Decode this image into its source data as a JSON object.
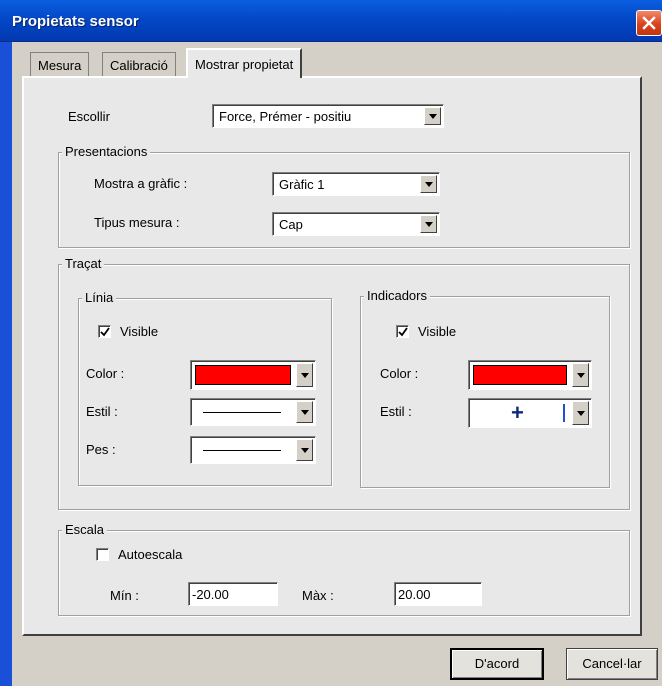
{
  "window": {
    "title": "Propietats sensor"
  },
  "tabs": [
    {
      "label": "Mesura",
      "active": false
    },
    {
      "label": "Calibració",
      "active": false
    },
    {
      "label": "Mostrar propietat",
      "active": true
    }
  ],
  "choose": {
    "label": "Escollir",
    "value": "Force, Prémer - positiu"
  },
  "presentations": {
    "title": "Presentacions",
    "show_graph": {
      "label": "Mostra a gràfic :",
      "value": "Gràfic 1"
    },
    "measure_type": {
      "label": "Tipus mesura :",
      "value": "Cap"
    }
  },
  "trace": {
    "title": "Traçat",
    "line": {
      "title": "Línia",
      "visible_label": "Visible",
      "visible_checked": true,
      "color_label": "Color :",
      "color_value": "#ff0000",
      "style_label": "Estil :",
      "weight_label": "Pes :"
    },
    "indicators": {
      "title": "Indicadors",
      "visible_label": "Visible",
      "visible_checked": true,
      "color_label": "Color :",
      "color_value": "#ff0000",
      "style_label": "Estil :",
      "style_symbol": "+"
    }
  },
  "scale": {
    "title": "Escala",
    "autoscale_label": "Autoescala",
    "autoscale_checked": false,
    "min_label": "Mín :",
    "min_value": "-20.00",
    "max_label": "Màx :",
    "max_value": "20.00"
  },
  "buttons": {
    "ok_label": "D'acord",
    "cancel_label": "Cancel·lar"
  },
  "icons": {
    "close": "close-icon",
    "dropdown": "chevron-down-icon",
    "check": "check-icon"
  }
}
